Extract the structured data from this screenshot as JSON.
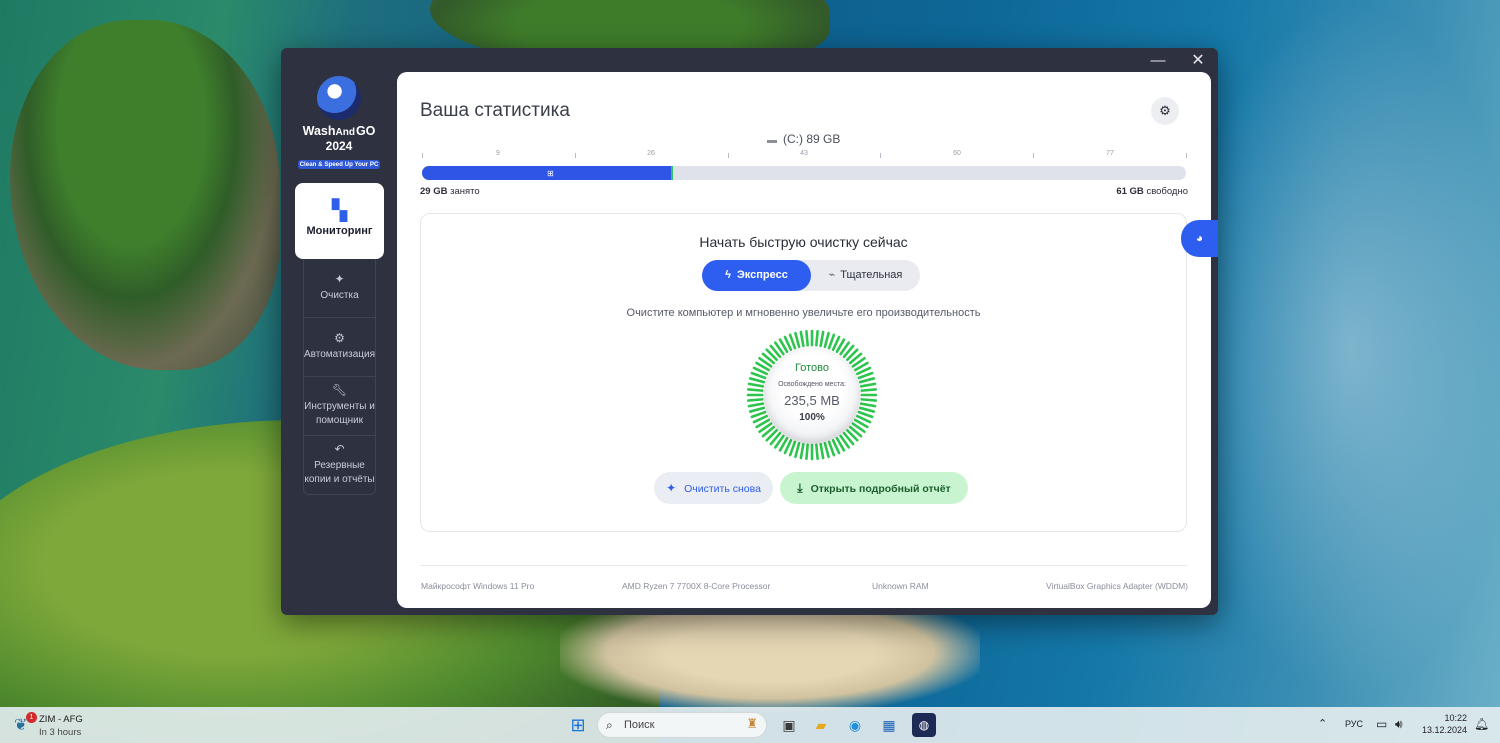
{
  "window": {
    "minimize_glyph": "—",
    "close_glyph": "✕"
  },
  "logo": {
    "name_part1": "Wash",
    "name_part2": "And",
    "name_part3": "GO",
    "year": "2024",
    "tagline": "Clean & Speed Up Your PC"
  },
  "sidebar": {
    "active": {
      "label": "Мониторинг",
      "icon": "dashboard-grid-icon"
    },
    "items": [
      {
        "label": "Очистка",
        "icon": "sparkle-icon"
      },
      {
        "label": "Автоматизация",
        "icon": "gear-icon"
      },
      {
        "label": "Инструменты и помощник",
        "icon": "wrench-icon"
      },
      {
        "label": "Резервные копии и отчёты",
        "icon": "undo-arrow-icon"
      }
    ]
  },
  "main": {
    "title": "Ваша статистика",
    "drive": {
      "label": "(C:) 89 GB",
      "total_gb": 89,
      "used_gb": 29,
      "ticks": [
        "9",
        "26",
        "43",
        "60",
        "77"
      ],
      "used_value": "29 GB",
      "used_suffix": "занято",
      "free_value": "61 GB",
      "free_suffix": "свободно"
    },
    "clean": {
      "title": "Начать быструю очистку сейчас",
      "mode_express": "Экспресс",
      "mode_thorough": "Тщательная",
      "description": "Очистите компьютер и мгновенно увеличьте его производительность",
      "gauge": {
        "status": "Готово",
        "freed_label": "Освобождено места:",
        "freed_value": "235,5 MB",
        "percent": "100%",
        "progress": 100,
        "color": "#2ec54f"
      },
      "btn_again": "Очистить снова",
      "btn_report": "Открыть подробный отчёт"
    },
    "sysinfo": {
      "os": "Майкрософт Windows 11 Pro",
      "cpu": "AMD Ryzen 7 7700X 8-Core Processor",
      "ram": "Unknown RAM",
      "gpu": "VirtualBox Graphics Adapter (WDDM)"
    }
  },
  "taskbar": {
    "weather_title": "ZIM - AFG",
    "weather_sub": "In 3 hours",
    "weather_badge": "1",
    "search_placeholder": "Поиск",
    "lang": "РУС",
    "time": "10:22",
    "date": "13.12.2024"
  },
  "colors": {
    "accent": "#2e5ef0",
    "success": "#2ec54f",
    "sidebar_bg": "#2e3140"
  }
}
